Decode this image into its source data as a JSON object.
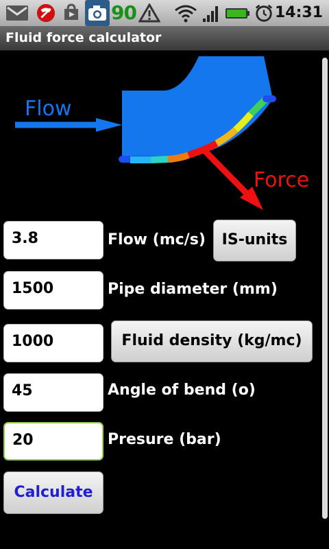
{
  "status_bar": {
    "icons": [
      "gmail-icon",
      "missed-call-icon",
      "play-store-icon",
      "camera-icon",
      "warning-icon",
      "wifi-icon",
      "signal-icon",
      "battery-icon",
      "alarm-icon"
    ],
    "battery_level": "90",
    "time": "14:31"
  },
  "app": {
    "title": "Fluid force calculator"
  },
  "diagram": {
    "flow_label": "Flow",
    "force_label": "Force",
    "colors": {
      "pipe": "#1477ee",
      "flow_arrow": "#1477ee",
      "force_arrow": "#ee1111"
    }
  },
  "form": {
    "flow": {
      "value": "3.8",
      "label": "Flow (mc/s)"
    },
    "diameter": {
      "value": "1500",
      "label": "Pipe diameter (mm)"
    },
    "density": {
      "value": "1000",
      "button_label": "Fluid density (kg/mc)"
    },
    "angle": {
      "value": "45",
      "label": "Angle of bend (o)"
    },
    "pressure": {
      "value": "20",
      "label": "Presure (bar)"
    },
    "units_button": "IS-units",
    "calculate_button": "Calculate"
  }
}
